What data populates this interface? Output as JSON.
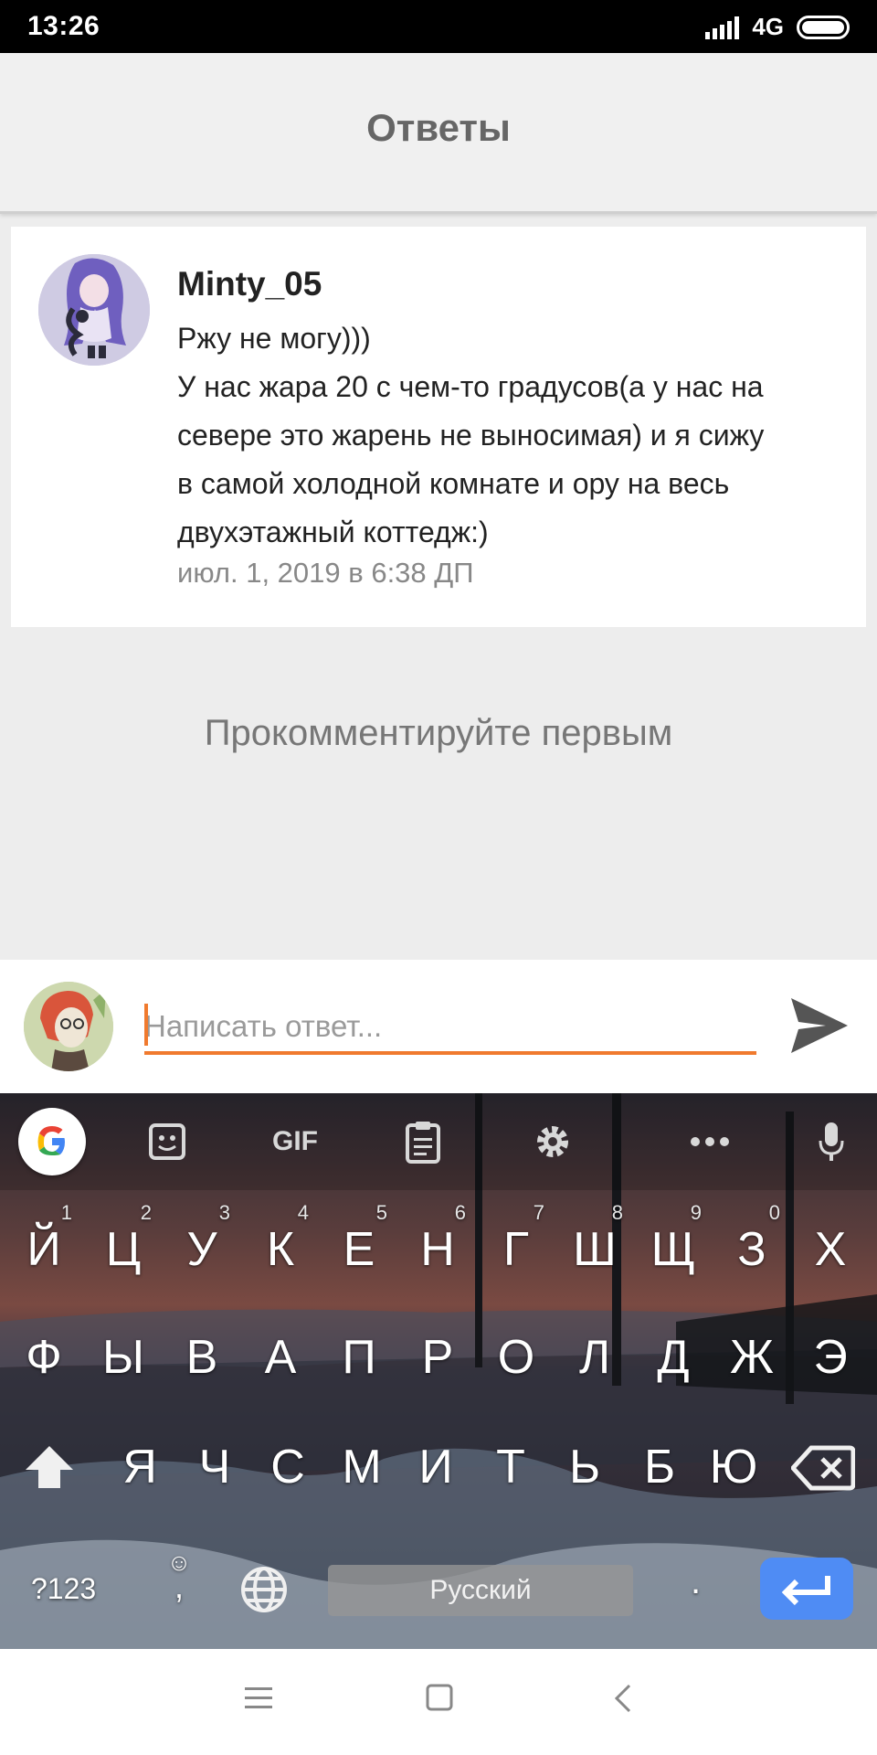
{
  "status_bar": {
    "time": "13:26",
    "network": "4G"
  },
  "header": {
    "title": "Ответы"
  },
  "comment": {
    "author": "Minty_05",
    "lines": [
      "Ржу не могу)))",
      "У нас жара 20 с чем-то градусов(а у нас на",
      "севере это жарень не выносимая) и я сижу",
      "в самой холодной комнате и ору на весь",
      "двухэтажный коттедж:)"
    ],
    "timestamp": "июл. 1, 2019 в 6:38 ДП"
  },
  "empty_hint": "Прокомментируйте первым",
  "reply": {
    "placeholder": "Написать ответ..."
  },
  "keyboard": {
    "toolbar": {
      "gif_label": "GIF"
    },
    "row1": [
      {
        "k": "Й",
        "n": "1"
      },
      {
        "k": "Ц",
        "n": "2"
      },
      {
        "k": "У",
        "n": "3"
      },
      {
        "k": "К",
        "n": "4"
      },
      {
        "k": "Е",
        "n": "5"
      },
      {
        "k": "Н",
        "n": "6"
      },
      {
        "k": "Г",
        "n": "7"
      },
      {
        "k": "Ш",
        "n": "8"
      },
      {
        "k": "Щ",
        "n": "9"
      },
      {
        "k": "З",
        "n": "0"
      },
      {
        "k": "Х",
        "n": ""
      }
    ],
    "row2": [
      "Ф",
      "Ы",
      "В",
      "А",
      "П",
      "Р",
      "О",
      "Л",
      "Д",
      "Ж",
      "Э"
    ],
    "row3": [
      "Я",
      "Ч",
      "С",
      "М",
      "И",
      "Т",
      "Ь",
      "Б",
      "Ю"
    ],
    "symbols_label": "?123",
    "comma_label": ",",
    "space_label": "Русский",
    "period_label": "."
  }
}
